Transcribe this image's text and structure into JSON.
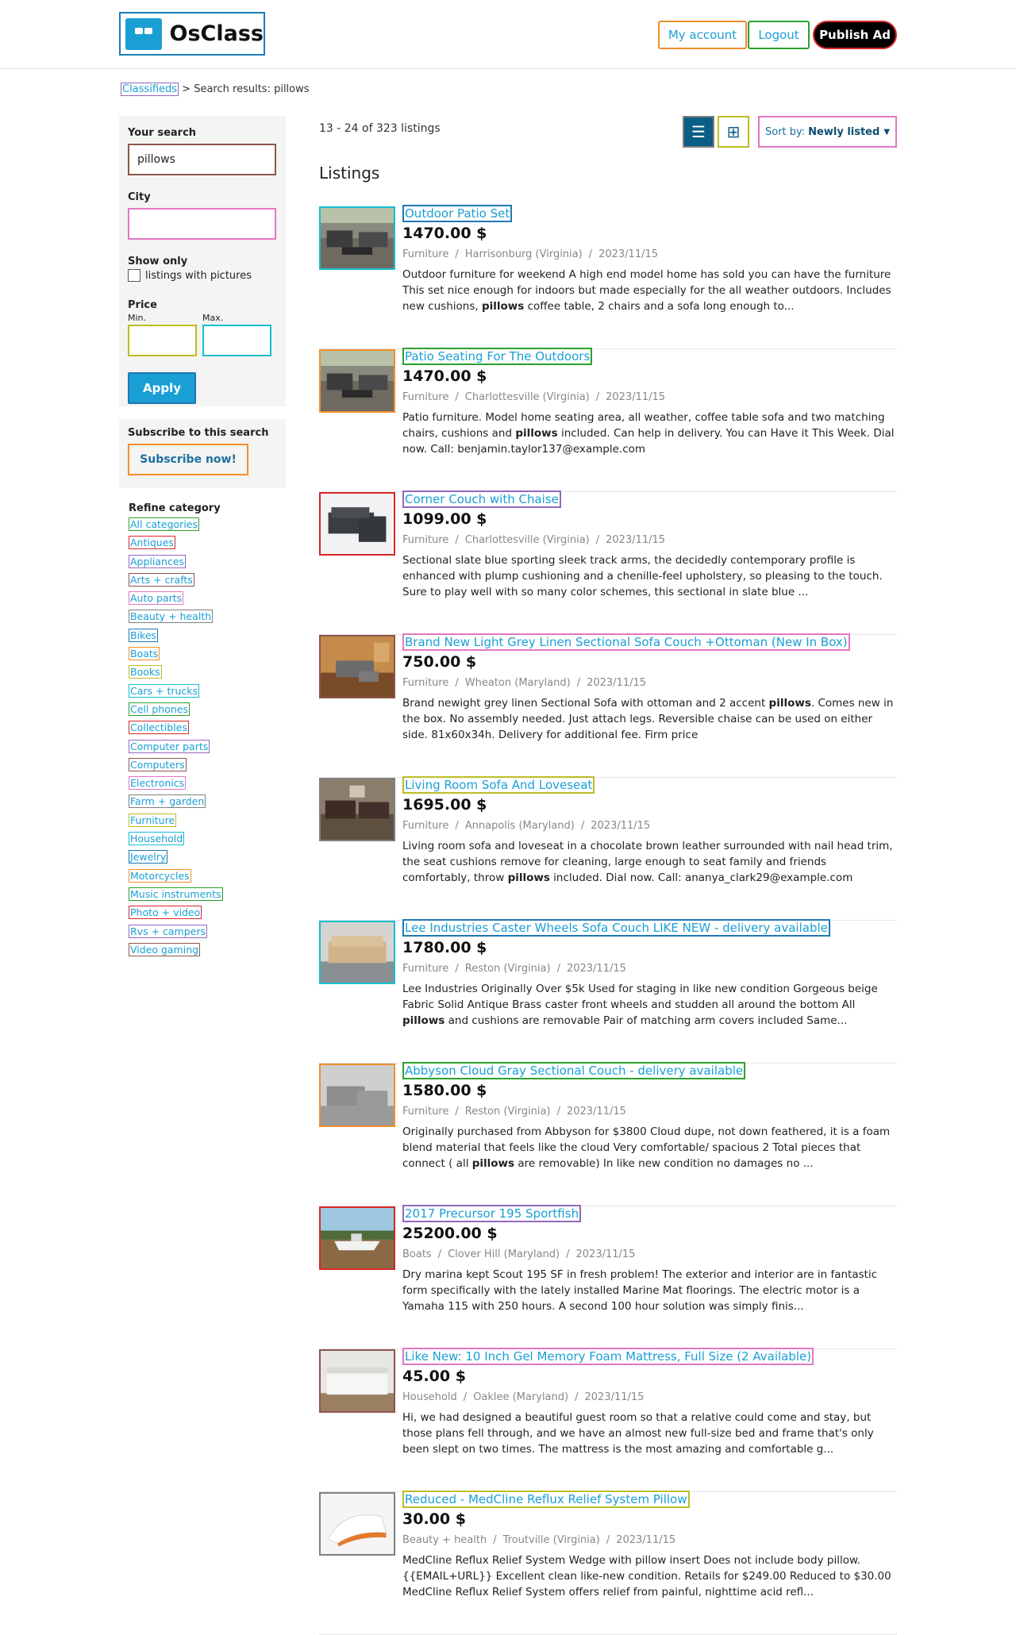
{
  "header": {
    "logo_text": "OsClass",
    "my_account": "My account",
    "logout": "Logout",
    "publish": "Publish Ad"
  },
  "breadcrumb": {
    "root": "Classifieds",
    "separator": ">",
    "current": "Search results: pillows"
  },
  "sidebar": {
    "your_search_label": "Your search",
    "search_value": "pillows",
    "city_label": "City",
    "city_value": "",
    "show_only_label": "Show only",
    "pictures_label": "listings with pictures",
    "price_label": "Price",
    "min_label": "Min.",
    "max_label": "Max.",
    "apply_label": "Apply",
    "subscribe_label": "Subscribe to this search",
    "subscribe_button": "Subscribe now!",
    "refine_label": "Refine category",
    "categories": [
      "All categories",
      "Antiques",
      "Appliances",
      "Arts + crafts",
      "Auto parts",
      "Beauty + health",
      "Bikes",
      "Boats",
      "Books",
      "Cars + trucks",
      "Cell phones",
      "Collectibles",
      "Computer parts",
      "Computers",
      "Electronics",
      "Farm + garden",
      "Furniture",
      "Household",
      "Jewelry",
      "Motorcycles",
      "Music instruments",
      "Photo + video",
      "Rvs + campers",
      "Video gaming"
    ]
  },
  "results": {
    "count_text": "13 - 24 of 323 listings",
    "sort_label": "Sort by:",
    "sort_value": "Newly listed",
    "listings_title": "Listings"
  },
  "listings": [
    {
      "title": "Outdoor Patio Set",
      "price": "1470.00 $",
      "category": "Furniture",
      "location": "Harrisonburg (Virginia)",
      "date": "2023/11/15",
      "desc_before": "Outdoor furniture for weekend A high end model home has sold you can have the furniture This set nice enough for indoors but made especially for the all weather outdoors. Includes new cushions, ",
      "desc_bold": "pillows",
      "desc_after": " coffee table, 2 chairs and a sofa long enough to...",
      "thumb": "patio"
    },
    {
      "title": "Patio Seating For The Outdoors",
      "price": "1470.00 $",
      "category": "Furniture",
      "location": "Charlottesville (Virginia)",
      "date": "2023/11/15",
      "desc_before": "Patio furniture. Model home seating area, all weather, coffee table sofa and two matching chairs, cushions and ",
      "desc_bold": "pillows",
      "desc_after": " included. Can help in delivery. You can Have it This Week. Dial now. Call: benjamin.taylor137@example.com",
      "thumb": "patio"
    },
    {
      "title": "Corner Couch with Chaise",
      "price": "1099.00 $",
      "category": "Furniture",
      "location": "Charlottesville (Virginia)",
      "date": "2023/11/15",
      "desc_before": "Sectional slate blue sporting sleek track arms, the decidedly contemporary profile is enhanced with plump cushioning and a chenille-feel upholstery, so pleasing to the touch. Sure to play well with so many color schemes, this sectional in slate blue ...",
      "desc_bold": "",
      "desc_after": "",
      "thumb": "couch-dark"
    },
    {
      "title": "Brand New Light Grey Linen Sectional Sofa Couch +Ottoman (New In Box)",
      "price": "750.00 $",
      "category": "Furniture",
      "location": "Wheaton (Maryland)",
      "date": "2023/11/15",
      "desc_before": "Brand newight grey linen Sectional Sofa with ottoman and 2 accent ",
      "desc_bold": "pillows",
      "desc_after": ". Comes new in the box. No assembly needed. Just attach legs. Reversible chaise can be used on either side. 81x60x34h. Delivery for additional fee. Firm price",
      "thumb": "room"
    },
    {
      "title": "Living Room Sofa And Loveseat",
      "price": "1695.00 $",
      "category": "Furniture",
      "location": "Annapolis (Maryland)",
      "date": "2023/11/15",
      "desc_before": "Living room sofa and loveseat in a chocolate brown leather surrounded with nail head trim, the seat cushions remove for cleaning, large enough to seat family and friends comfortably, throw ",
      "desc_bold": "pillows",
      "desc_after": " included. Dial now. Call: ananya_clark29@example.com",
      "thumb": "living"
    },
    {
      "title": "Lee Industries Caster Wheels Sofa Couch LIKE NEW - delivery available",
      "price": "1780.00 $",
      "category": "Furniture",
      "location": "Reston (Virginia)",
      "date": "2023/11/15",
      "desc_before": "Lee Industries Originally Over $5k Used for staging in like new condition Gorgeous beige Fabric Solid Antique Brass caster front wheels and studden all around the bottom All ",
      "desc_bold": "pillows",
      "desc_after": " and cushions are removable Pair of matching arm covers included Same...",
      "thumb": "beige"
    },
    {
      "title": "Abbyson Cloud Gray Sectional Couch - delivery available",
      "price": "1580.00 $",
      "category": "Furniture",
      "location": "Reston (Virginia)",
      "date": "2023/11/15",
      "desc_before": "Originally purchased from Abbyson for $3800 Cloud dupe, not down feathered, it is a foam blend material that feels like the cloud Very comfortable/ spacious 2 Total pieces that connect ( all ",
      "desc_bold": "pillows",
      "desc_after": " are removable) In like new condition no damages no ...",
      "thumb": "gray"
    },
    {
      "title": "2017 Precursor 195 Sportfish",
      "price": "25200.00 $",
      "category": "Boats",
      "location": "Clover Hill (Maryland)",
      "date": "2023/11/15",
      "desc_before": "Dry marina kept Scout 195 SF in fresh problem! The exterior and interior are in fantastic form specifically with the lately installed Marine Mat floorings. The electric motor is a Yamaha 115 with 250 hours. A second 100 hour solution was simply finis...",
      "desc_bold": "",
      "desc_after": "",
      "thumb": "boat"
    },
    {
      "title": "Like New: 10 Inch Gel Memory Foam Mattress, Full Size (2 Available)",
      "price": "45.00 $",
      "category": "Household",
      "location": "Oaklee (Maryland)",
      "date": "2023/11/15",
      "desc_before": "Hi, we had designed a beautiful guest room so that a relative could come and stay, but those plans fell through, and we have an almost new full-size bed and frame that's only been slept on two times. The mattress is the most amazing and comfortable g...",
      "desc_bold": "",
      "desc_after": "",
      "thumb": "bed"
    },
    {
      "title": "Reduced - MedCline Reflux Relief System Pillow",
      "price": "30.00 $",
      "category": "Beauty + health",
      "location": "Troutville (Virginia)",
      "date": "2023/11/15",
      "desc_before": "MedCline Reflux Relief System Wedge with pillow insert Does not include body pillow. {{EMAIL+URL}} Excellent clean like-new condition. Retails for $249.00 Reduced to $30.00 MedCline Reflux Relief System offers relief from painful, nighttime acid refl...",
      "desc_bold": "",
      "desc_after": "",
      "thumb": "pillow"
    }
  ],
  "colors": {
    "accent": "#1a9fd5",
    "dark_accent": "#0b5e86",
    "outline_palette": [
      "#1f77b4",
      "#f28e2b",
      "#2ca02c",
      "#d62728",
      "#9467bd",
      "#8c564b",
      "#e377c2",
      "#7f7f7f",
      "#bcbd22",
      "#17becf"
    ]
  }
}
